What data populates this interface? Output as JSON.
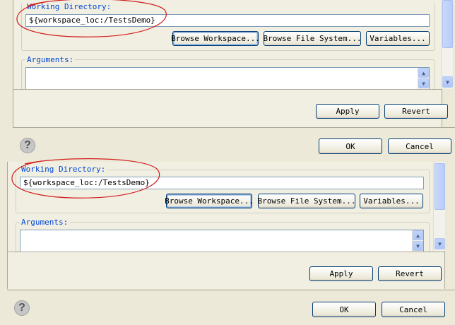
{
  "top": {
    "working_dir_label": "Working Directory:",
    "working_dir_value": "${workspace_loc:/TestsDemo}",
    "browse_workspace": "Browse Workspace...",
    "browse_file_system": "Browse File System...",
    "variables": "Variables...",
    "arguments_label": "Arguments:",
    "apply": "Apply",
    "revert": "Revert",
    "ok": "OK",
    "cancel": "Cancel",
    "help_glyph": "?"
  },
  "bottom": {
    "working_dir_label": "Working Directory:",
    "working_dir_value": "${workspace_loc:/TestsDemo}",
    "browse_workspace": "Browse Workspace...",
    "browse_file_system": "Browse File System...",
    "variables": "Variables...",
    "arguments_label": "Arguments:",
    "apply": "Apply",
    "revert": "Revert",
    "ok": "OK",
    "cancel": "Cancel",
    "help_glyph": "?"
  },
  "colors": {
    "annotation": "#d21e1e",
    "label": "#0046d5",
    "dialog_bg": "#ece9d8"
  },
  "icons": [
    "help-icon",
    "scroll-up-icon",
    "scroll-down-icon"
  ]
}
